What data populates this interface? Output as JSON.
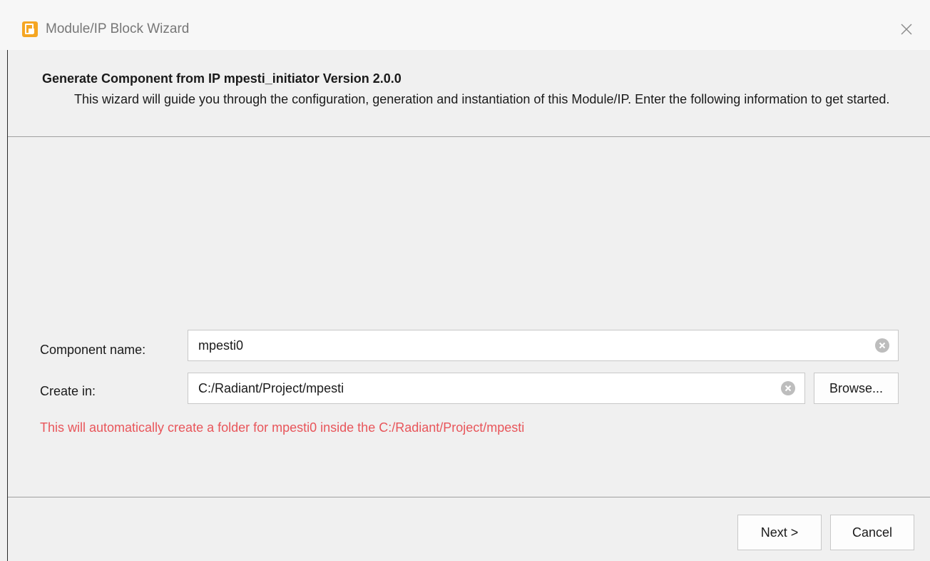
{
  "window": {
    "title": "Module/IP Block Wizard",
    "app_icon": "radiant-logo-icon",
    "close_icon": "close-icon"
  },
  "header": {
    "title": "Generate Component from IP mpesti_initiator Version 2.0.0",
    "description": "This wizard will guide you through the configuration, generation and instantiation of this Module/IP. Enter the following information to get started."
  },
  "form": {
    "component_name": {
      "label": "Component name:",
      "value": "mpesti0"
    },
    "create_in": {
      "label": "Create in:",
      "value": "C:/Radiant/Project/mpesti",
      "browse_label": "Browse..."
    },
    "info_message": "This will automatically create a folder for mpesti0 inside the C:/Radiant/Project/mpesti"
  },
  "footer": {
    "next_label": "Next >",
    "cancel_label": "Cancel"
  },
  "colors": {
    "info_message": "#e8555a",
    "app_icon": "#f5a623",
    "clear_icon": "#bdbdbd"
  }
}
